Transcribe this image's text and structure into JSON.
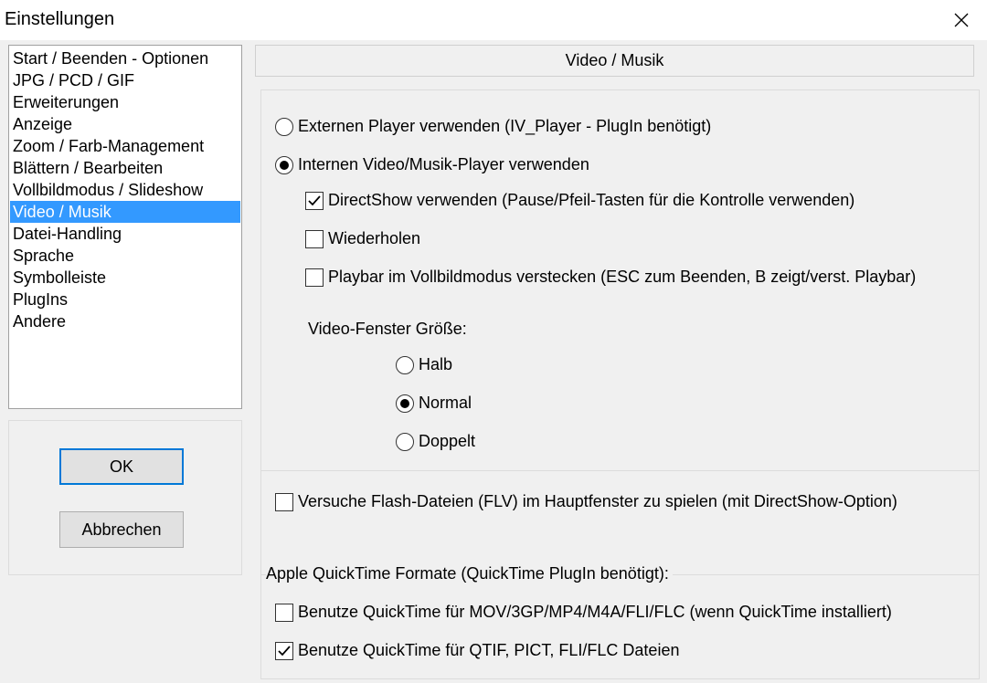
{
  "window": {
    "title": "Einstellungen",
    "close_icon": "close-icon"
  },
  "sidebar": {
    "items": [
      {
        "label": "Start / Beenden - Optionen",
        "selected": false
      },
      {
        "label": "JPG / PCD / GIF",
        "selected": false
      },
      {
        "label": "Erweiterungen",
        "selected": false
      },
      {
        "label": "Anzeige",
        "selected": false
      },
      {
        "label": "Zoom / Farb-Management",
        "selected": false
      },
      {
        "label": "Blättern / Bearbeiten",
        "selected": false
      },
      {
        "label": "Vollbildmodus / Slideshow",
        "selected": false
      },
      {
        "label": "Video / Musik",
        "selected": true
      },
      {
        "label": "Datei-Handling",
        "selected": false
      },
      {
        "label": "Sprache",
        "selected": false
      },
      {
        "label": "Symbolleiste",
        "selected": false
      },
      {
        "label": "PlugIns",
        "selected": false
      },
      {
        "label": "Andere",
        "selected": false
      }
    ],
    "selected_color": "#3399ff"
  },
  "buttons": {
    "ok": "OK",
    "cancel": "Abbrechen"
  },
  "main": {
    "header": "Video / Musik",
    "player": {
      "external_label": "Externen Player verwenden (IV_Player - PlugIn benötigt)",
      "external_checked": false,
      "internal_label": "Internen Video/Musik-Player verwenden",
      "internal_checked": true,
      "directshow_label": "DirectShow verwenden (Pause/Pfeil-Tasten für die Kontrolle verwenden)",
      "directshow_checked": true,
      "repeat_label": "Wiederholen",
      "repeat_checked": false,
      "hide_playbar_label": "Playbar im Vollbildmodus verstecken (ESC zum Beenden, B zeigt/verst. Playbar)",
      "hide_playbar_checked": false,
      "window_size_label": "Video-Fenster Größe:",
      "size_half": "Halb",
      "size_normal": "Normal",
      "size_double": "Doppelt",
      "size_selected": "Normal"
    },
    "flash": {
      "label": "Versuche Flash-Dateien (FLV) im Hauptfenster zu spielen (mit DirectShow-Option)",
      "checked": false
    },
    "quicktime": {
      "group_label": "Apple QuickTime Formate (QuickTime PlugIn benötigt):",
      "mov_label": "Benutze QuickTime für MOV/3GP/MP4/M4A/FLI/FLC (wenn QuickTime installiert)",
      "mov_checked": false,
      "qtif_label": "Benutze QuickTime für QTIF, PICT, FLI/FLC Dateien",
      "qtif_checked": true
    }
  }
}
